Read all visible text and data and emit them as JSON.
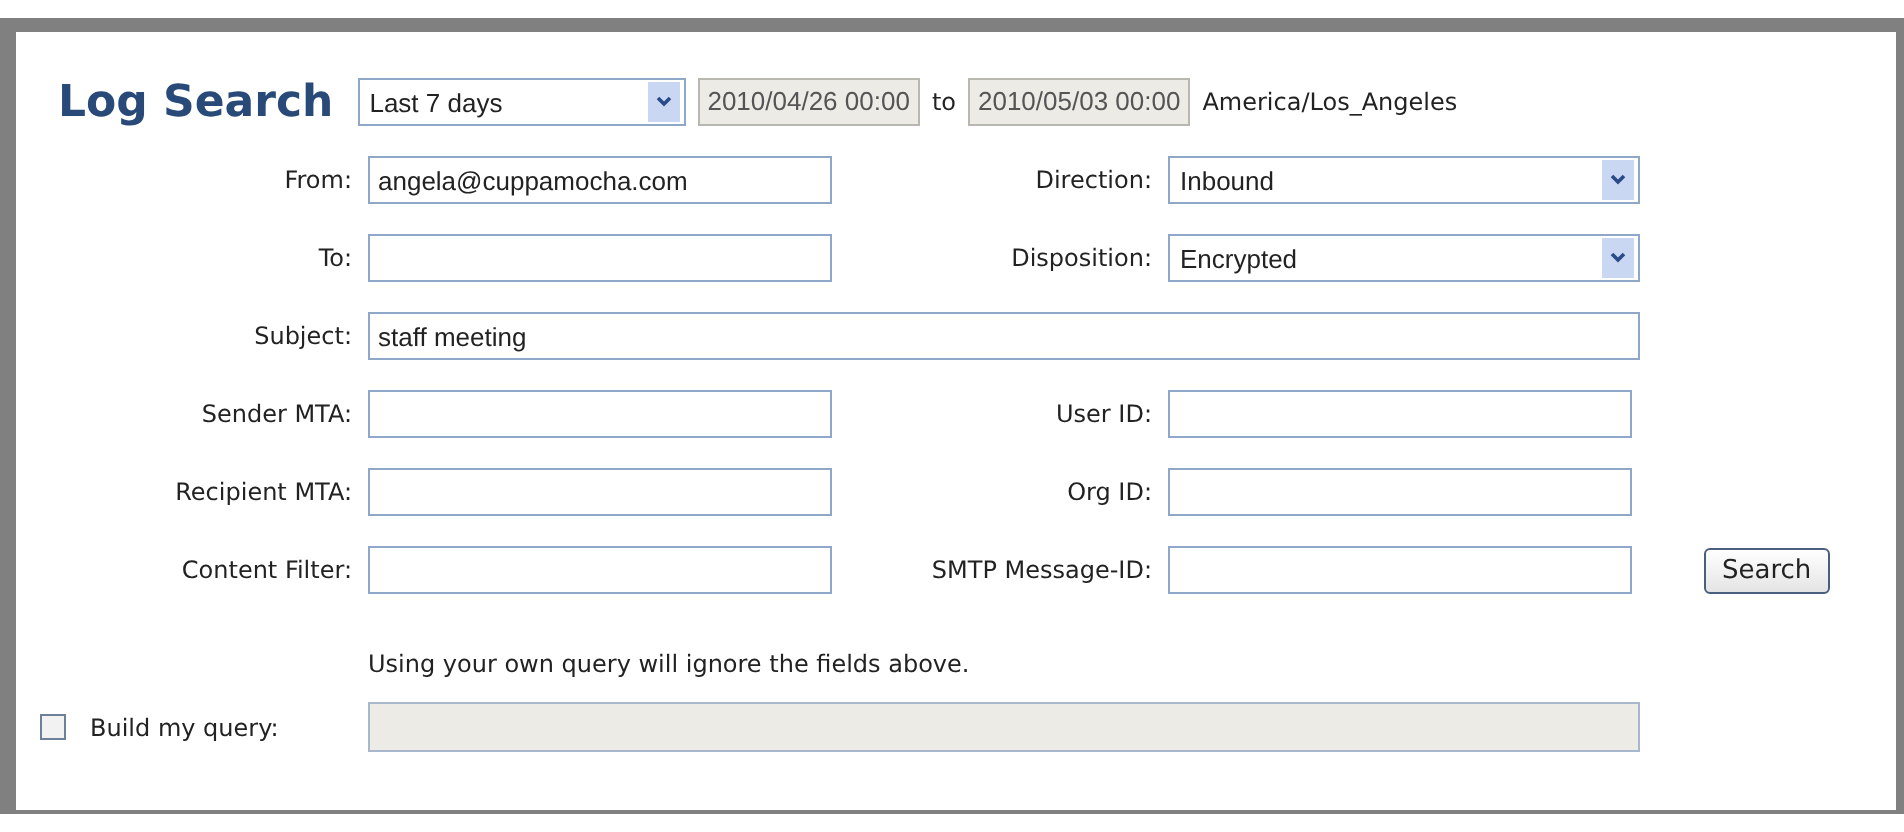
{
  "title": "Log Search",
  "range": {
    "value": "Last 7 days",
    "start": "2010/04/26 00:00",
    "to_label": "to",
    "end": "2010/05/03 00:00",
    "timezone": "America/Los_Angeles"
  },
  "rows": [
    [
      {
        "label": "From:",
        "kind": "text",
        "value": "angela@cuppamocha.com"
      },
      {
        "label": "Direction:",
        "kind": "select",
        "value": "Inbound"
      }
    ],
    [
      {
        "label": "To:",
        "kind": "text"
      },
      {
        "label": "Disposition:",
        "kind": "select",
        "value": "Encrypted"
      }
    ],
    [
      {
        "label": "Subject:",
        "kind": "text",
        "value": "staff meeting"
      }
    ],
    [
      {
        "label": "Sender MTA:",
        "kind": "text"
      },
      {
        "label": "User ID:",
        "kind": "text"
      }
    ],
    [
      {
        "label": "Recipient MTA:",
        "kind": "text"
      },
      {
        "label": "Org ID:",
        "kind": "text"
      }
    ],
    [
      {
        "label": "Content Filter:",
        "kind": "text"
      },
      {
        "label": "SMTP Message-ID:",
        "kind": "text"
      }
    ]
  ],
  "search_button": "Search",
  "note": "Using your own query will ignore the fields above.",
  "build_query": {
    "label": "Build my query:",
    "checked": false,
    "disabled": true
  }
}
